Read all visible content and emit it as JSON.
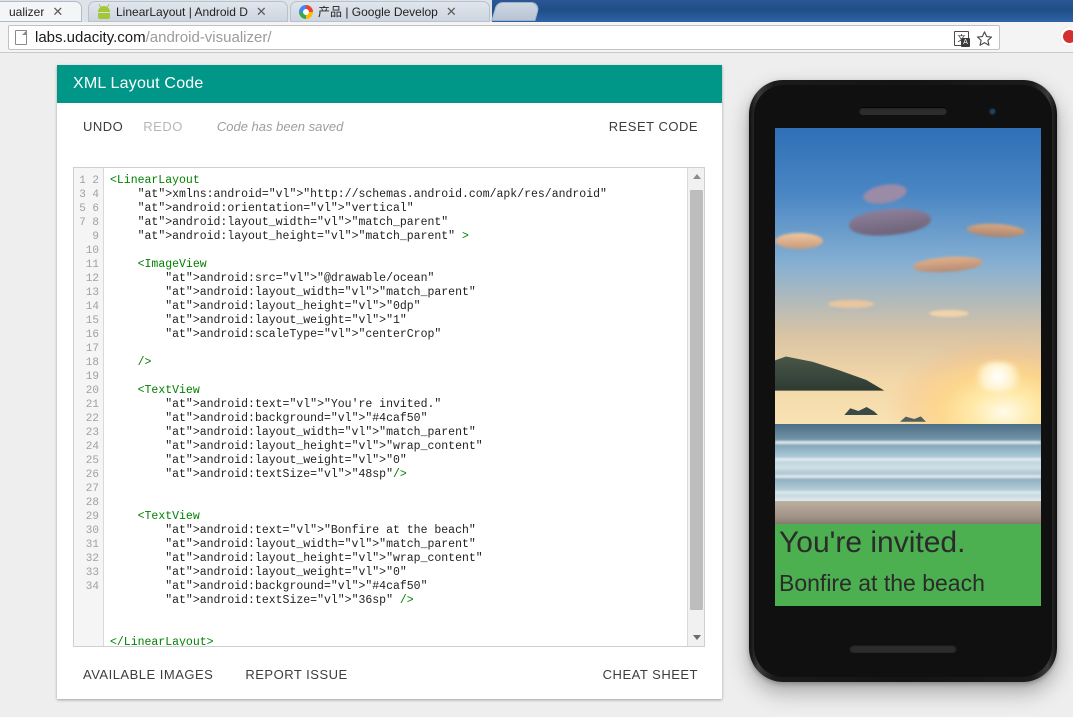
{
  "browser": {
    "tabs": [
      {
        "title": "ualizer",
        "favicon": "none",
        "active": true
      },
      {
        "title": "LinearLayout | Android D",
        "favicon": "android-icon",
        "active": false
      },
      {
        "title": "产品  |  Google Develop",
        "favicon": "google-developers-icon",
        "active": false
      }
    ],
    "close_label": "✕",
    "omnibox": {
      "host": "labs.udacity.com",
      "path": "/android-visualizer/",
      "page_icon": "page-icon",
      "translate_icon": "translate-icon",
      "translate_glyph": "文",
      "translate_badge": "A",
      "bookmark_icon": "star-icon"
    }
  },
  "card": {
    "header_title": "XML Layout Code",
    "toolbar": {
      "undo_label": "UNDO",
      "redo_label": "REDO",
      "status_text": "Code has been saved",
      "reset_label": "RESET CODE"
    },
    "footer": {
      "available_images_label": "AVAILABLE IMAGES",
      "report_issue_label": "REPORT ISSUE",
      "cheat_sheet_label": "CHEAT SHEET"
    },
    "editor": {
      "line_count": 34,
      "lines": [
        "<LinearLayout",
        "    xmlns:android=\"http://schemas.android.com/apk/res/android\"",
        "    android:orientation=\"vertical\"",
        "    android:layout_width=\"match_parent\"",
        "    android:layout_height=\"match_parent\" >",
        "",
        "    <ImageView",
        "        android:src=\"@drawable/ocean\"",
        "        android:layout_width=\"match_parent\"",
        "        android:layout_height=\"0dp\"",
        "        android:layout_weight=\"1\"",
        "        android:scaleType=\"centerCrop\"",
        "",
        "    />",
        "",
        "    <TextView",
        "        android:text=\"You're invited.\"",
        "        android:background=\"#4caf50\"",
        "        android:layout_width=\"match_parent\"",
        "        android:layout_height=\"wrap_content\"",
        "        android:layout_weight=\"0\"",
        "        android:textSize=\"48sp\"/>",
        "",
        "",
        "    <TextView",
        "        android:text=\"Bonfire at the beach\"",
        "        android:layout_width=\"match_parent\"",
        "        android:layout_height=\"wrap_content\"",
        "        android:layout_weight=\"0\"",
        "        android:background=\"#4caf50\"",
        "        android:textSize=\"36sp\" />",
        "",
        "",
        "</LinearLayout>"
      ]
    }
  },
  "preview": {
    "device": "android-phone",
    "image_name": "ocean",
    "headline": "You're invited.",
    "subhead": "Bonfire at the beach",
    "overlay_color": "#4caf50"
  },
  "colors": {
    "header_teal": "#009688",
    "overlay_green": "#4caf50",
    "page_background": "#eeeeee",
    "code_tag": "#008000",
    "code_attr": "#00008b",
    "code_value": "#a52a2a"
  }
}
